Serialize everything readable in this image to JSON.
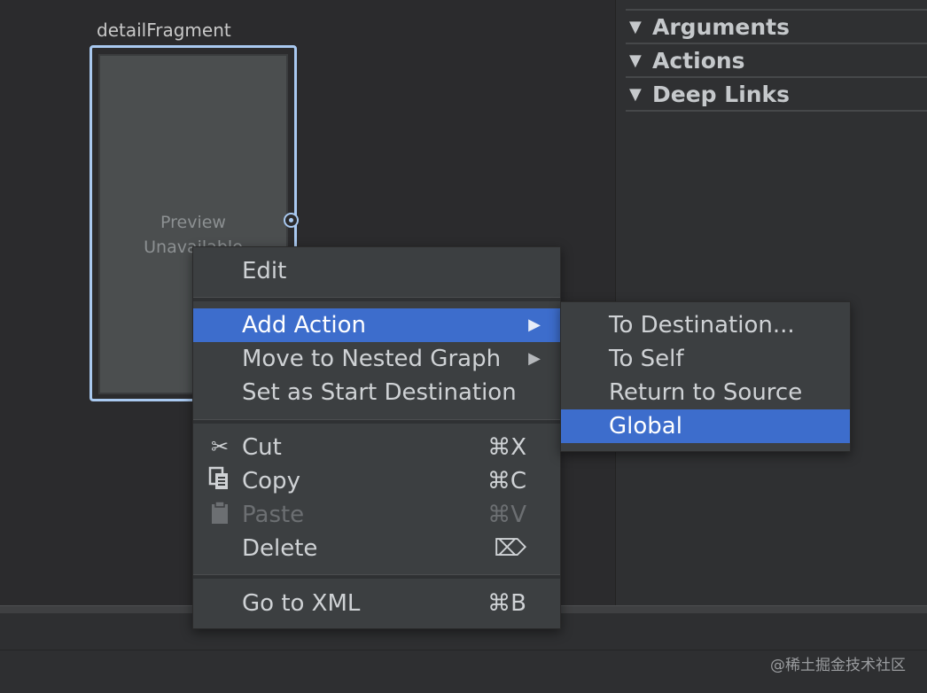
{
  "canvas": {
    "fragment_title": "detailFragment",
    "preview_line1": "Preview",
    "preview_line2": "Unavailable"
  },
  "attributes_panel": {
    "sections": [
      {
        "label": "Arguments"
      },
      {
        "label": "Actions"
      },
      {
        "label": "Deep Links"
      }
    ]
  },
  "context_menu": {
    "edit": "Edit",
    "add_action": "Add Action",
    "move_to_nested_graph": "Move to Nested Graph",
    "set_start_destination": "Set as Start Destination",
    "cut": {
      "label": "Cut",
      "shortcut": "⌘X",
      "icon": "scissors-icon"
    },
    "copy": {
      "label": "Copy",
      "shortcut": "⌘C",
      "icon": "copy-icon"
    },
    "paste": {
      "label": "Paste",
      "shortcut": "⌘V",
      "icon": "clipboard-icon",
      "disabled": true
    },
    "delete": {
      "label": "Delete",
      "shortcut": "⌦",
      "shortcut_icon": "delete-key-icon"
    },
    "go_to_xml": {
      "label": "Go to XML",
      "shortcut": "⌘B"
    }
  },
  "add_action_submenu": {
    "items": [
      {
        "label": "To Destination..."
      },
      {
        "label": "To Self"
      },
      {
        "label": "Return to Source"
      },
      {
        "label": "Global",
        "selected": true
      }
    ]
  },
  "watermark": "@稀土掘金技术社区",
  "colors": {
    "selection": "#3d6dcc",
    "selection_border": "#a9c9f0",
    "menu_bg": "#3c3f41",
    "canvas_bg": "#2b2b2d"
  }
}
